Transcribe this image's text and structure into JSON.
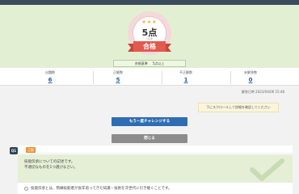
{
  "score": {
    "value": "5点",
    "sub": "5点中",
    "stars": "★★★",
    "verdict": "合格"
  },
  "pass_line": {
    "label": "合格基準",
    "value": "5点以上"
  },
  "stats": [
    {
      "label": "出題数",
      "value": "6"
    },
    {
      "label": "正解数",
      "value": "5"
    },
    {
      "label": "不正解数",
      "value": "1"
    },
    {
      "label": "未解答数",
      "value": "0"
    }
  ],
  "answered_at": "解答日時 2023/04/06 15:48",
  "scroll_hint": "下にスクロールして詳細を確認してください",
  "buttons": {
    "retry": "もう一度チャレンジする",
    "close": "閉じる"
  },
  "question": {
    "number": "Q1",
    "badge": "正解",
    "text_line1": "技能伝承についての記述です。",
    "text_line2": "不適切なものを1つ選びなさい。",
    "option1": "技能伝承とは、熟練技能者が長年培ってきた知識・技術を次世代に引き継ぐことです。"
  },
  "colors": {
    "accent_blue": "#2f6db3",
    "ribbon_red": "#e05a4e",
    "result_bg": "#e3efd3",
    "check_green": "#c8dcb4"
  }
}
